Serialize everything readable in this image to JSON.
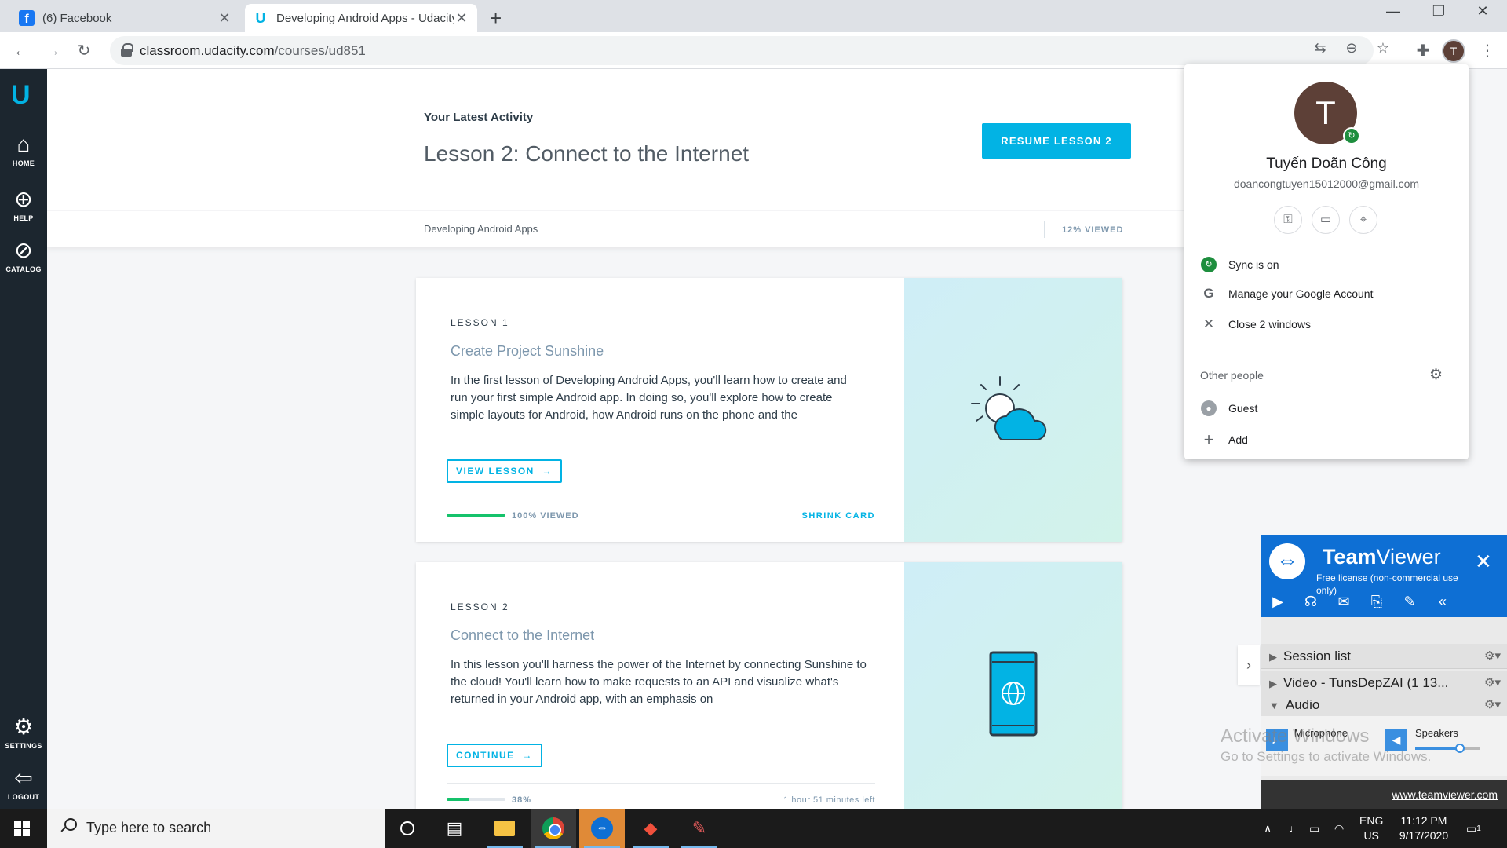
{
  "browser": {
    "tabs": [
      {
        "title": "(6) Facebook",
        "icon": "facebook-icon",
        "active": false
      },
      {
        "title": "Developing Android Apps - Udacity",
        "icon": "udacity-icon",
        "active": true
      }
    ],
    "url_host": "classroom.udacity.com",
    "url_path": "/courses/ud851"
  },
  "leftnav": {
    "items": [
      {
        "label": "HOME",
        "icon": "home-icon"
      },
      {
        "label": "HELP",
        "icon": "help-lifebuoy-icon"
      },
      {
        "label": "CATALOG",
        "icon": "compass-icon"
      },
      {
        "label": "SETTINGS",
        "icon": "gear-icon"
      },
      {
        "label": "LOGOUT",
        "icon": "logout-icon"
      }
    ]
  },
  "activity": {
    "label": "Your Latest Activity",
    "lesson": "Lesson 2: Connect to the Internet",
    "resume_button": "RESUME LESSON 2"
  },
  "course": {
    "name": "Developing Android Apps",
    "viewed": "12% VIEWED"
  },
  "lessons": [
    {
      "number": "LESSON 1",
      "title": "Create Project Sunshine",
      "description": "In the first lesson of Developing Android Apps, you'll learn how to create and run your first simple Android app. In doing so, you'll explore how to create simple layouts for Android, how Android runs on the phone and the",
      "button": "VIEW LESSON",
      "progress_fraction": 1.0,
      "progress_text": "100% VIEWED",
      "footer_right": "SHRINK CARD",
      "art": "sun-cloud-icon"
    },
    {
      "number": "LESSON 2",
      "title": "Connect to the Internet",
      "description": "In this lesson you'll harness the power of the Internet by connecting Sunshine to the cloud! You'll learn how to make requests to an API and visualize what's returned in your Android app, with an emphasis on",
      "button": "CONTINUE",
      "progress_fraction": 0.38,
      "progress_text": "38%",
      "footer_right": "1 hour 51 minutes left",
      "art": "phone-globe-icon"
    }
  ],
  "profile": {
    "initial": "T",
    "name": "Tuyến Doãn Công",
    "email": "doancongtuyen15012000@gmail.com",
    "sync": "Sync is on",
    "manage": "Manage your Google Account",
    "close": "Close 2 windows",
    "other_people": "Other people",
    "guest": "Guest",
    "add": "Add"
  },
  "teamviewer": {
    "brand_bold": "Team",
    "brand_rest": "Viewer",
    "license": "Free license (non-commercial use only)",
    "session_list": "Session list",
    "video": "Video - TunsDepZAI (1 13...",
    "audio": "Audio",
    "microphone": "Microphone",
    "speakers": "Speakers",
    "speaker_level": 0.7,
    "link": "www.teamviewer.com"
  },
  "watermark": {
    "line1": "Activate Windows",
    "line2": "Go to Settings to activate Windows."
  },
  "taskbar": {
    "search_placeholder": "Type here to search",
    "lang_top": "ENG",
    "lang_bottom": "US",
    "time": "11:12 PM",
    "date": "9/17/2020",
    "notifications": "1"
  },
  "colors": {
    "udacity_blue": "#02b3e4",
    "progress_green": "#15c26b",
    "nav_dark": "#1c262f",
    "teamviewer_blue": "#0e6fd4"
  }
}
